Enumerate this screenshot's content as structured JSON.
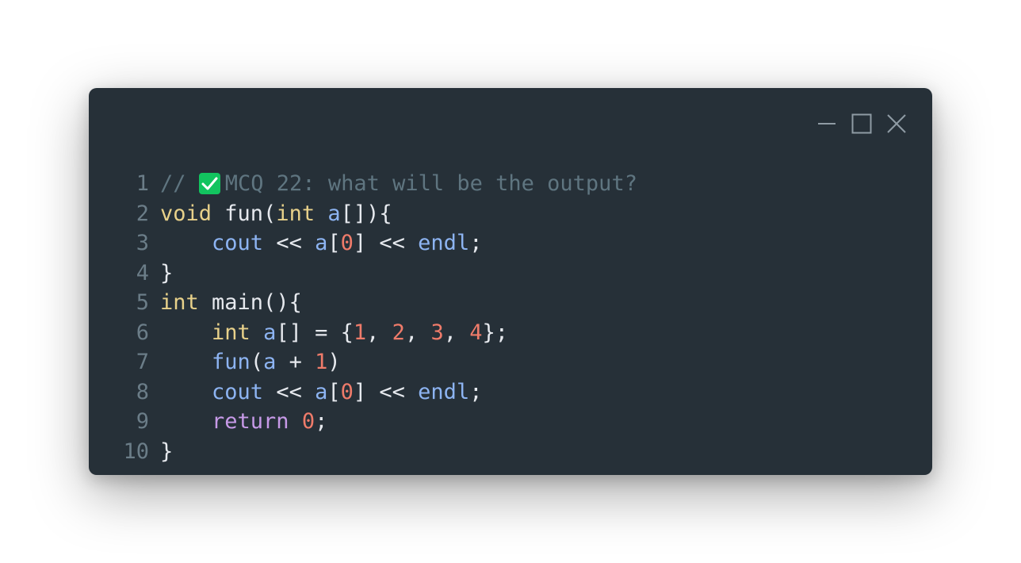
{
  "window": {
    "controls": {
      "minimize_icon": "minimize-icon",
      "maximize_icon": "maximize-icon",
      "close_icon": "close-icon"
    }
  },
  "colors": {
    "background": "#263038",
    "comment": "#5f7580",
    "type": "#e8d18a",
    "variable": "#8db4f2",
    "number": "#ef7b6a",
    "keyword": "#c79ae8",
    "check": "#12c45f"
  },
  "code": {
    "lines": [
      {
        "n": "1",
        "tokens": [
          {
            "t": "comment",
            "v": "// "
          },
          {
            "t": "icon",
            "v": "check-icon"
          },
          {
            "t": "comment",
            "v": "MCQ 22: what will be the output?"
          }
        ]
      },
      {
        "n": "2",
        "tokens": [
          {
            "t": "type",
            "v": "void"
          },
          {
            "t": "punc",
            "v": " fun("
          },
          {
            "t": "type",
            "v": "int"
          },
          {
            "t": "punc",
            "v": " "
          },
          {
            "t": "var",
            "v": "a"
          },
          {
            "t": "punc",
            "v": "[]){"
          }
        ]
      },
      {
        "n": "3",
        "tokens": [
          {
            "t": "punc",
            "v": "    "
          },
          {
            "t": "var",
            "v": "cout"
          },
          {
            "t": "punc",
            "v": " << "
          },
          {
            "t": "var",
            "v": "a"
          },
          {
            "t": "punc",
            "v": "["
          },
          {
            "t": "num",
            "v": "0"
          },
          {
            "t": "punc",
            "v": "] << "
          },
          {
            "t": "var",
            "v": "endl"
          },
          {
            "t": "punc",
            "v": ";"
          }
        ]
      },
      {
        "n": "4",
        "tokens": [
          {
            "t": "punc",
            "v": "}"
          }
        ]
      },
      {
        "n": "5",
        "tokens": [
          {
            "t": "type",
            "v": "int"
          },
          {
            "t": "punc",
            "v": " main(){"
          }
        ]
      },
      {
        "n": "6",
        "tokens": [
          {
            "t": "punc",
            "v": "    "
          },
          {
            "t": "type",
            "v": "int"
          },
          {
            "t": "punc",
            "v": " "
          },
          {
            "t": "var",
            "v": "a"
          },
          {
            "t": "punc",
            "v": "[] = {"
          },
          {
            "t": "num",
            "v": "1"
          },
          {
            "t": "punc",
            "v": ", "
          },
          {
            "t": "num",
            "v": "2"
          },
          {
            "t": "punc",
            "v": ", "
          },
          {
            "t": "num",
            "v": "3"
          },
          {
            "t": "punc",
            "v": ", "
          },
          {
            "t": "num",
            "v": "4"
          },
          {
            "t": "punc",
            "v": "};"
          }
        ]
      },
      {
        "n": "7",
        "tokens": [
          {
            "t": "punc",
            "v": "    "
          },
          {
            "t": "var",
            "v": "fun"
          },
          {
            "t": "punc",
            "v": "("
          },
          {
            "t": "var",
            "v": "a"
          },
          {
            "t": "punc",
            "v": " + "
          },
          {
            "t": "num",
            "v": "1"
          },
          {
            "t": "punc",
            "v": ")"
          }
        ]
      },
      {
        "n": "8",
        "tokens": [
          {
            "t": "punc",
            "v": "    "
          },
          {
            "t": "var",
            "v": "cout"
          },
          {
            "t": "punc",
            "v": " << "
          },
          {
            "t": "var",
            "v": "a"
          },
          {
            "t": "punc",
            "v": "["
          },
          {
            "t": "num",
            "v": "0"
          },
          {
            "t": "punc",
            "v": "] << "
          },
          {
            "t": "var",
            "v": "endl"
          },
          {
            "t": "punc",
            "v": ";"
          }
        ]
      },
      {
        "n": "9",
        "tokens": [
          {
            "t": "punc",
            "v": "    "
          },
          {
            "t": "kw",
            "v": "return"
          },
          {
            "t": "punc",
            "v": " "
          },
          {
            "t": "num",
            "v": "0"
          },
          {
            "t": "punc",
            "v": ";"
          }
        ]
      },
      {
        "n": "10",
        "tokens": [
          {
            "t": "punc",
            "v": "}"
          }
        ]
      }
    ]
  }
}
